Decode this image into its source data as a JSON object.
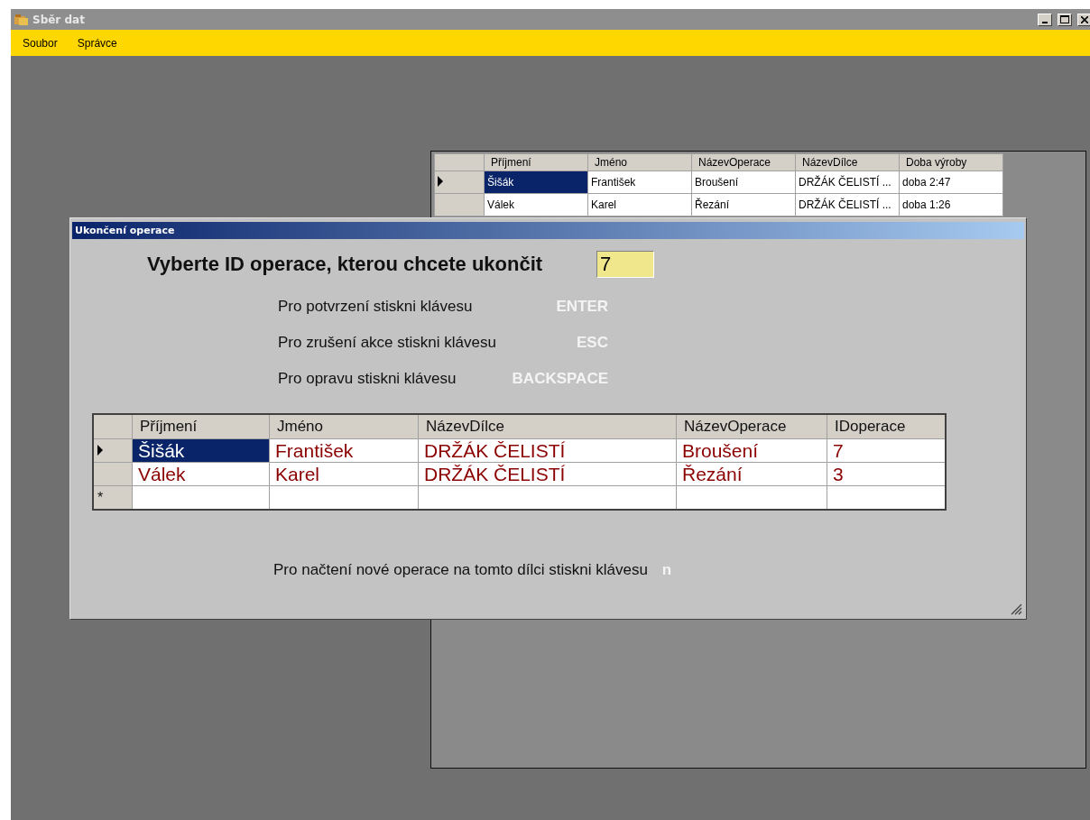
{
  "window": {
    "title": "Sběr dat"
  },
  "menu": [
    {
      "label": "Soubor"
    },
    {
      "label": "Správce"
    }
  ],
  "back_grid": {
    "columns": [
      "Příjmení",
      "Jméno",
      "NázevOperace",
      "NázevDílce",
      "Doba výroby"
    ],
    "rows": [
      {
        "selected": true,
        "cells": [
          "Šišák",
          "František",
          "Broušení",
          "DRŽÁK ČELISTÍ ...",
          "doba 2:47"
        ]
      },
      {
        "selected": false,
        "cells": [
          "Válek",
          "Karel",
          "Řezání",
          "DRŽÁK ČELISTÍ ...",
          "doba 1:26"
        ]
      }
    ]
  },
  "dialog": {
    "title": "Ukončení operace",
    "prompt": "Vyberte ID operace, kterou chcete ukončit",
    "id_field": {
      "value": "7"
    },
    "hints": [
      {
        "text": "Pro potvrzení stiskni klávesu",
        "key": "ENTER"
      },
      {
        "text": "Pro zrušení akce stiskni klávesu",
        "key": "ESC"
      },
      {
        "text": "Pro opravu stiskni klávesu",
        "key": "BACKSPACE"
      }
    ],
    "grid": {
      "columns": [
        "Příjmení",
        "Jméno",
        "NázevDílce",
        "NázevOperace",
        "IDoperace"
      ],
      "rows": [
        {
          "selected": true,
          "cells": [
            "Šišák",
            "František",
            "DRŽÁK ČELISTÍ",
            "Broušení",
            "7"
          ]
        },
        {
          "selected": false,
          "cells": [
            "Válek",
            "Karel",
            "DRŽÁK ČELISTÍ",
            "Řezání",
            "3"
          ]
        }
      ],
      "new_row_marker": "*"
    },
    "footer": {
      "text": "Pro načtení nové operace na tomto dílci stiskni klávesu",
      "key": "n"
    }
  }
}
